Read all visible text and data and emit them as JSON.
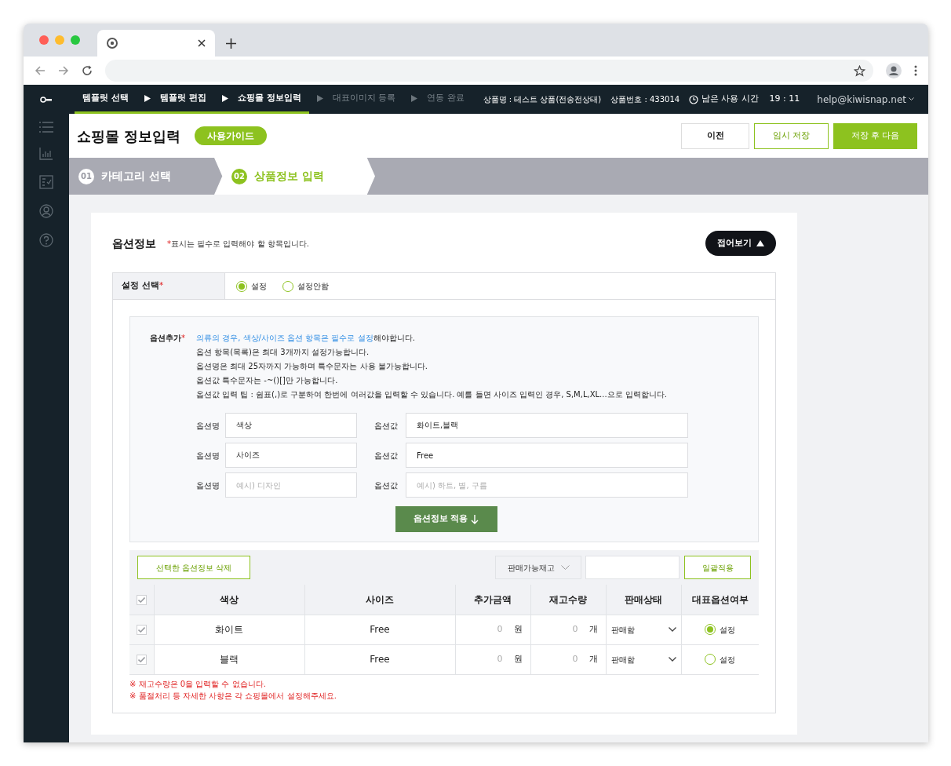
{
  "header": {
    "steps": [
      {
        "label": "템플릿 선택",
        "completed": true
      },
      {
        "label": "템플릿 편집",
        "completed": true
      },
      {
        "label": "쇼핑몰 정보입력",
        "completed": true
      },
      {
        "label": "대표이미지 등록",
        "completed": false
      },
      {
        "label": "연동 완료",
        "completed": false
      }
    ],
    "product_name": "상품명 : 테스트 상품(전송전상태)",
    "product_number": "상품번호 : 433014",
    "timer_label": "남은 사용 시간",
    "time": "19 : 11",
    "user": "help@kiwisnap.net"
  },
  "page": {
    "title": "쇼핑몰 정보입력",
    "guide_button": "사용가이드",
    "buttons": [
      {
        "label": "이전",
        "kind": "plain"
      },
      {
        "label": "임시 저장",
        "kind": "outline"
      },
      {
        "label": "저장 후 다음",
        "kind": "primary"
      }
    ]
  },
  "wizard": [
    {
      "number": "01",
      "label": "카테고리 선택",
      "selected": false
    },
    {
      "number": "02",
      "label": "상품정보 입력",
      "selected": true
    }
  ],
  "section": {
    "title": "옵션정보",
    "required_mark": "*",
    "note": "표시는 필수로 입력해야 할 항목입니다.",
    "collapse_button": "접어보기",
    "setting": {
      "label": "설정 선택",
      "required_mark": "*",
      "options": [
        {
          "label": "설정",
          "selected": true
        },
        {
          "label": "설정안함",
          "selected": false
        }
      ]
    },
    "option_add": {
      "label": "옵션추가",
      "required_mark": "*",
      "highlight": "의류의 경우, 색상/사이즈 옵션 항목은 필수로 설정",
      "highlight_rest": "해야합니다.",
      "lines": [
        "옵션 항목(목록)은 최대 3개까지 설정가능합니다.",
        "옵션명은 최대 25자까지 가능하며 특수문자는 사용 불가능합니다.",
        "옵션값 특수문자는 -~()[]만 가능합니다.",
        "옵션값 입력 팁 : 쉼표(,)로 구분하여 한번에 여러값을 입력할 수 있습니다. 예를 들면 사이즈 입력인 경우, S,M,L,XL...으로 입력합니다."
      ],
      "rows": [
        {
          "name_label": "옵션명",
          "name": {
            "value": "색상"
          },
          "value_label": "옵션값",
          "values": {
            "value": "화이트,블랙"
          }
        },
        {
          "name_label": "옵션명",
          "name": {
            "value": "사이즈"
          },
          "value_label": "옵션값",
          "values": {
            "value": "Free"
          }
        },
        {
          "name_label": "옵션명",
          "name": {
            "placeholder": "예시) 디자인"
          },
          "value_label": "옵션값",
          "values": {
            "placeholder": "예시) 하트, 별, 구름"
          }
        }
      ],
      "apply_button": "옵션정보 적용"
    },
    "toolbar": {
      "delete_button": "선택한 옵션정보 삭제",
      "dropdown": "판매가능재고",
      "apply_button": "일괄적용"
    },
    "table": {
      "header_checked": true,
      "columns": [
        "색상",
        "사이즈",
        "추가금액",
        "재고수량",
        "판매상태",
        "대표옵션여부"
      ],
      "rows": [
        {
          "checked": true,
          "color_option": "화이트",
          "size": "Free",
          "price": "0",
          "price_unit": "원",
          "stock": "0",
          "stock_unit": "개",
          "status": "판매함",
          "representative": {
            "label": "설정",
            "selected": true
          }
        },
        {
          "checked": true,
          "color_option": "블랙",
          "size": "Free",
          "price": "0",
          "price_unit": "원",
          "stock": "0",
          "stock_unit": "개",
          "status": "판매함",
          "representative": {
            "label": "설정",
            "selected": false
          }
        }
      ]
    },
    "notes": [
      "※ 재고수량은 0을 입력할 수 없습니다.",
      "※ 품절처리 등 자세한 사항은 각 쇼핑몰에서 설정해주세요."
    ]
  }
}
